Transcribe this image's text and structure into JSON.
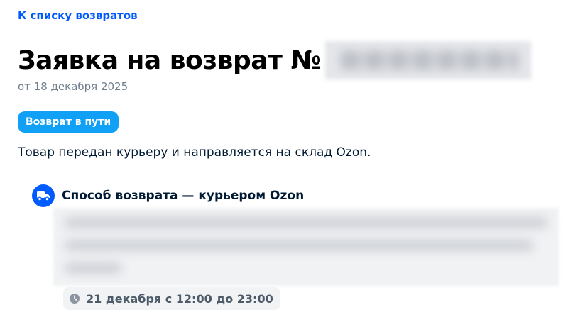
{
  "breadcrumb": {
    "back_label": "К списку возвратов"
  },
  "header": {
    "title": "Заявка на возврат №",
    "order_number_redacted": true,
    "date": "от 18 декабря 2025"
  },
  "status": {
    "badge_label": "Возврат в пути",
    "badge_color": "#10a0f5",
    "description": "Товар передан курьеру и направляется на склад Ozon."
  },
  "return_method": {
    "icon": "truck-icon",
    "title": "Способ возврата — курьером Ozon",
    "address_redacted": true,
    "delivery_window": "21 декабря с 12:00 до 23:00",
    "delivery_icon": "clock-icon"
  },
  "colors": {
    "accent": "#005bff",
    "text": "#001a34",
    "muted": "#707f8d"
  }
}
